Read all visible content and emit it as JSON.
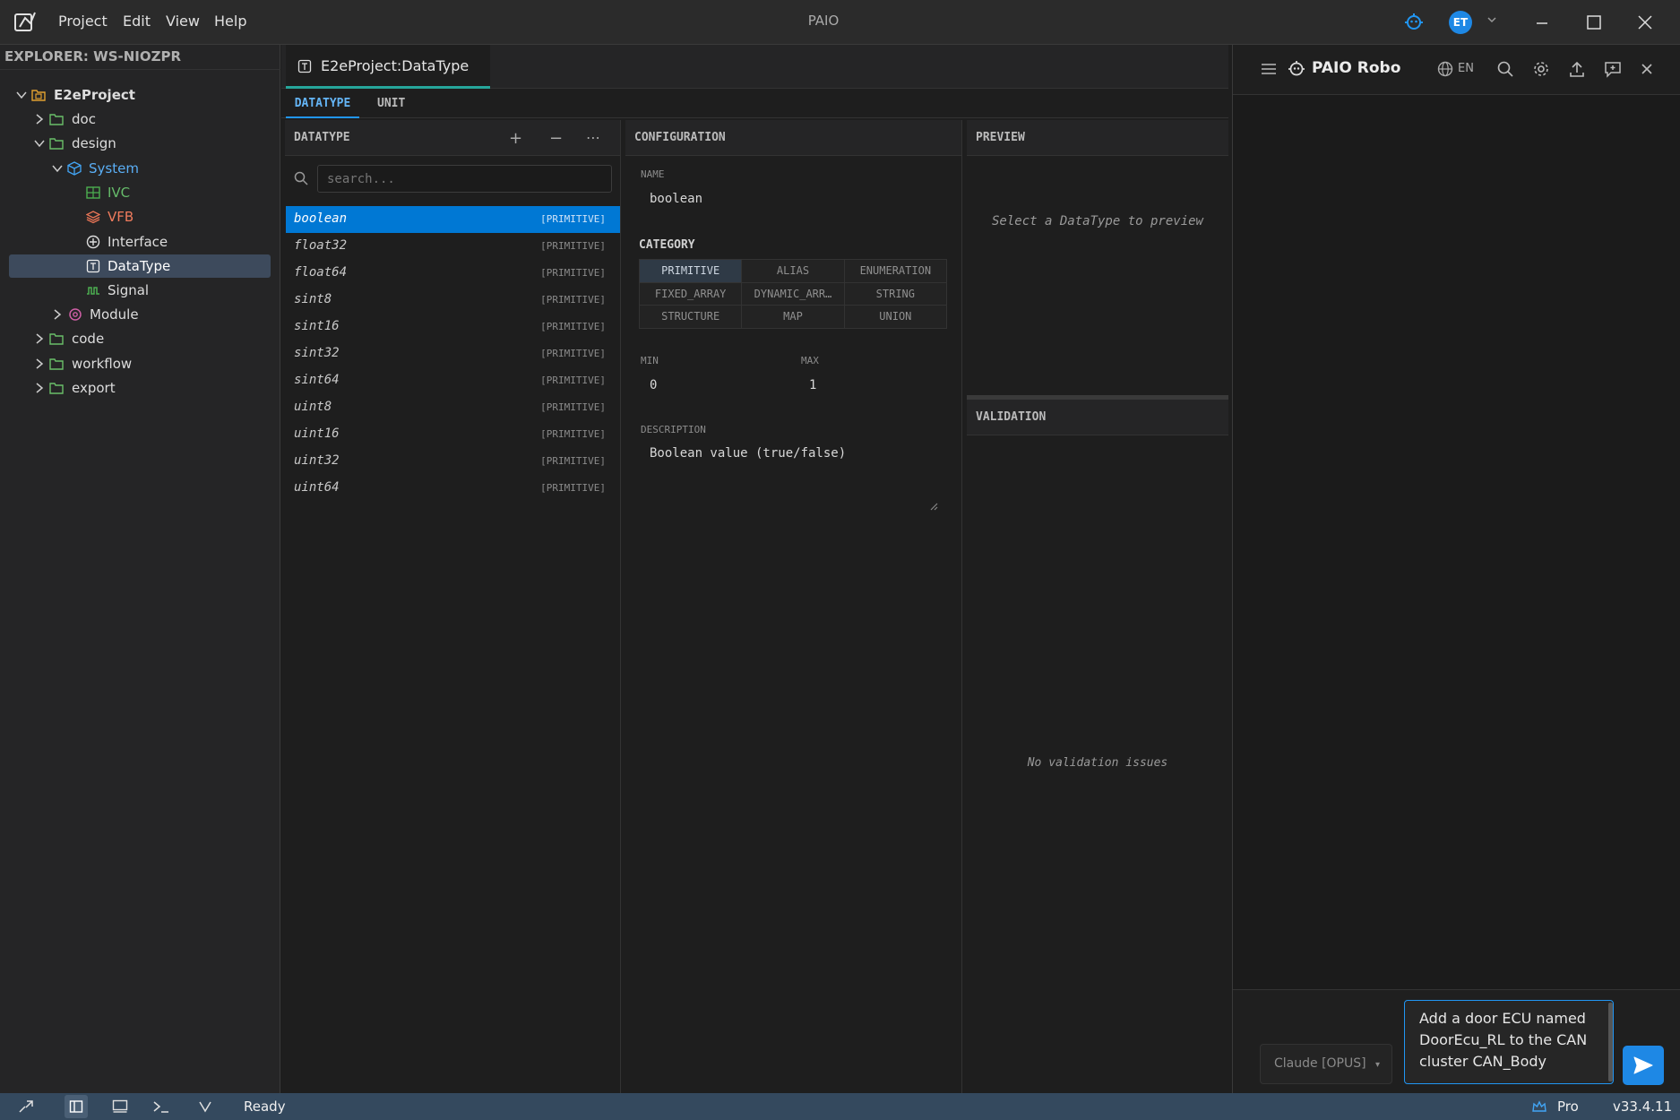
{
  "titlebar": {
    "menu": [
      "Project",
      "Edit",
      "View",
      "Help"
    ],
    "title": "PAIO",
    "user_initials": "ET"
  },
  "explorer": {
    "header": "EXPLORER: WS-NIOZPR",
    "tree": [
      {
        "label": "E2eProject",
        "icon": "project-icon"
      },
      {
        "label": "doc",
        "icon": "folder-icon"
      },
      {
        "label": "design",
        "icon": "folder-icon"
      },
      {
        "label": "System",
        "icon": "cube-icon"
      },
      {
        "label": "IVC",
        "icon": "grid-icon"
      },
      {
        "label": "VFB",
        "icon": "layers-icon"
      },
      {
        "label": "Interface",
        "icon": "interface-icon"
      },
      {
        "label": "DataType",
        "icon": "datatype-icon"
      },
      {
        "label": "Signal",
        "icon": "signal-icon"
      },
      {
        "label": "Module",
        "icon": "module-icon"
      },
      {
        "label": "code",
        "icon": "folder-icon"
      },
      {
        "label": "workflow",
        "icon": "folder-icon"
      },
      {
        "label": "export",
        "icon": "folder-icon"
      }
    ]
  },
  "editor": {
    "tab_label": "E2eProject:DataType",
    "sub_tabs": [
      "DATATYPE",
      "UNIT"
    ]
  },
  "datatype_panel": {
    "title": "DATATYPE",
    "add": "+",
    "remove": "−",
    "more": "⋯",
    "search_placeholder": "search...",
    "items": [
      {
        "name": "boolean",
        "kind": "[PRIMITIVE]"
      },
      {
        "name": "float32",
        "kind": "[PRIMITIVE]"
      },
      {
        "name": "float64",
        "kind": "[PRIMITIVE]"
      },
      {
        "name": "sint8",
        "kind": "[PRIMITIVE]"
      },
      {
        "name": "sint16",
        "kind": "[PRIMITIVE]"
      },
      {
        "name": "sint32",
        "kind": "[PRIMITIVE]"
      },
      {
        "name": "sint64",
        "kind": "[PRIMITIVE]"
      },
      {
        "name": "uint8",
        "kind": "[PRIMITIVE]"
      },
      {
        "name": "uint16",
        "kind": "[PRIMITIVE]"
      },
      {
        "name": "uint32",
        "kind": "[PRIMITIVE]"
      },
      {
        "name": "uint64",
        "kind": "[PRIMITIVE]"
      }
    ]
  },
  "configuration": {
    "title": "CONFIGURATION",
    "name_label": "NAME",
    "name_value": "boolean",
    "category_label": "CATEGORY",
    "categories": [
      "PRIMITIVE",
      "ALIAS",
      "ENUMERATION",
      "FIXED_ARRAY",
      "DYNAMIC_ARR…",
      "STRING",
      "STRUCTURE",
      "MAP",
      "UNION"
    ],
    "min_label": "MIN",
    "min_value": "0",
    "max_label": "MAX",
    "max_value": "1",
    "description_label": "DESCRIPTION",
    "description_value": "Boolean value (true/false)"
  },
  "preview": {
    "title": "PREVIEW",
    "empty_text": "Select a DataType to preview"
  },
  "validation": {
    "title": "VALIDATION",
    "empty_text": "No validation issues"
  },
  "robo": {
    "title": "PAIO Robo",
    "lang": "EN",
    "model": "Claude [OPUS]",
    "model_caret": "▾",
    "input_text": "Add a door ECU named DoorEcu_RL to the CAN cluster CAN_Body"
  },
  "statusbar": {
    "status": "Ready",
    "plan": "Pro",
    "version": "v33.4.11"
  },
  "colors": {
    "accent": "#0078d4",
    "tab_underline": "#26a69a",
    "statusbar": "#34495e"
  }
}
